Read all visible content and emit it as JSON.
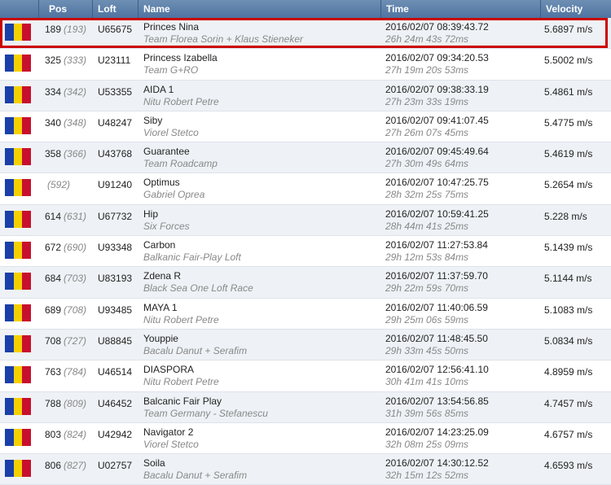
{
  "columns": {
    "flag": "",
    "pos": "Pos",
    "loft": "Loft",
    "name": "Name",
    "time": "Time",
    "velocity": "Velocity"
  },
  "flag_colors": [
    "#1a3fa8",
    "#f5d000",
    "#c8102e"
  ],
  "highlight_color": "#cc0000",
  "rows": [
    {
      "pos": "189",
      "pos_sub": "(193)",
      "loft": "U65675",
      "name": "Princes Nina",
      "team": "Team Florea Sorin + Klaus Stieneker",
      "time": "2016/02/07 08:39:43.72",
      "duration": "26h 24m 43s 72ms",
      "velocity": "5.6897 m/s",
      "highlighted": true
    },
    {
      "pos": "325",
      "pos_sub": "(333)",
      "loft": "U23111",
      "name": "Princess Izabella",
      "team": "Team G+RO",
      "time": "2016/02/07 09:34:20.53",
      "duration": "27h 19m 20s 53ms",
      "velocity": "5.5002 m/s"
    },
    {
      "pos": "334",
      "pos_sub": "(342)",
      "loft": "U53355",
      "name": "AIDA 1",
      "team": "Nitu Robert Petre",
      "time": "2016/02/07 09:38:33.19",
      "duration": "27h 23m 33s 19ms",
      "velocity": "5.4861 m/s"
    },
    {
      "pos": "340",
      "pos_sub": "(348)",
      "loft": "U48247",
      "name": "Siby",
      "team": "Viorel Stetco",
      "time": "2016/02/07 09:41:07.45",
      "duration": "27h 26m 07s 45ms",
      "velocity": "5.4775 m/s"
    },
    {
      "pos": "358",
      "pos_sub": "(366)",
      "loft": "U43768",
      "name": "Guarantee",
      "team": "Team Roadcamp",
      "time": "2016/02/07 09:45:49.64",
      "duration": "27h 30m 49s 64ms",
      "velocity": "5.4619 m/s"
    },
    {
      "pos": "",
      "pos_sub": "(592)",
      "loft": "U91240",
      "name": "Optimus",
      "team": "Gabriel Oprea",
      "time": "2016/02/07 10:47:25.75",
      "duration": "28h 32m 25s 75ms",
      "velocity": "5.2654 m/s"
    },
    {
      "pos": "614",
      "pos_sub": "(631)",
      "loft": "U67732",
      "name": "Hip",
      "team": "Six Forces",
      "time": "2016/02/07 10:59:41.25",
      "duration": "28h 44m 41s 25ms",
      "velocity": "5.228 m/s"
    },
    {
      "pos": "672",
      "pos_sub": "(690)",
      "loft": "U93348",
      "name": "Carbon",
      "team": "Balkanic Fair-Play Loft",
      "time": "2016/02/07 11:27:53.84",
      "duration": "29h 12m 53s 84ms",
      "velocity": "5.1439 m/s"
    },
    {
      "pos": "684",
      "pos_sub": "(703)",
      "loft": "U83193",
      "name": "Zdena R",
      "team": "Black Sea One Loft Race",
      "time": "2016/02/07 11:37:59.70",
      "duration": "29h 22m 59s 70ms",
      "velocity": "5.1144 m/s"
    },
    {
      "pos": "689",
      "pos_sub": "(708)",
      "loft": "U93485",
      "name": "MAYA 1",
      "team": "Nitu Robert Petre",
      "time": "2016/02/07 11:40:06.59",
      "duration": "29h 25m 06s 59ms",
      "velocity": "5.1083 m/s"
    },
    {
      "pos": "708",
      "pos_sub": "(727)",
      "loft": "U88845",
      "name": "Youppie",
      "team": "Bacalu Danut + Serafim",
      "time": "2016/02/07 11:48:45.50",
      "duration": "29h 33m 45s 50ms",
      "velocity": "5.0834 m/s"
    },
    {
      "pos": "763",
      "pos_sub": "(784)",
      "loft": "U46514",
      "name": "DIASPORA",
      "team": "Nitu Robert Petre",
      "time": "2016/02/07 12:56:41.10",
      "duration": "30h 41m 41s 10ms",
      "velocity": "4.8959 m/s"
    },
    {
      "pos": "788",
      "pos_sub": "(809)",
      "loft": "U46452",
      "name": "Balcanic Fair Play",
      "team": "Team Germany - Stefanescu",
      "time": "2016/02/07 13:54:56.85",
      "duration": "31h 39m 56s 85ms",
      "velocity": "4.7457 m/s"
    },
    {
      "pos": "803",
      "pos_sub": "(824)",
      "loft": "U42942",
      "name": "Navigator 2",
      "team": "Viorel Stetco",
      "time": "2016/02/07 14:23:25.09",
      "duration": "32h 08m 25s 09ms",
      "velocity": "4.6757 m/s"
    },
    {
      "pos": "806",
      "pos_sub": "(827)",
      "loft": "U02757",
      "name": "Soila",
      "team": "Bacalu Danut + Serafim",
      "time": "2016/02/07 14:30:12.52",
      "duration": "32h 15m 12s 52ms",
      "velocity": "4.6593 m/s"
    }
  ]
}
